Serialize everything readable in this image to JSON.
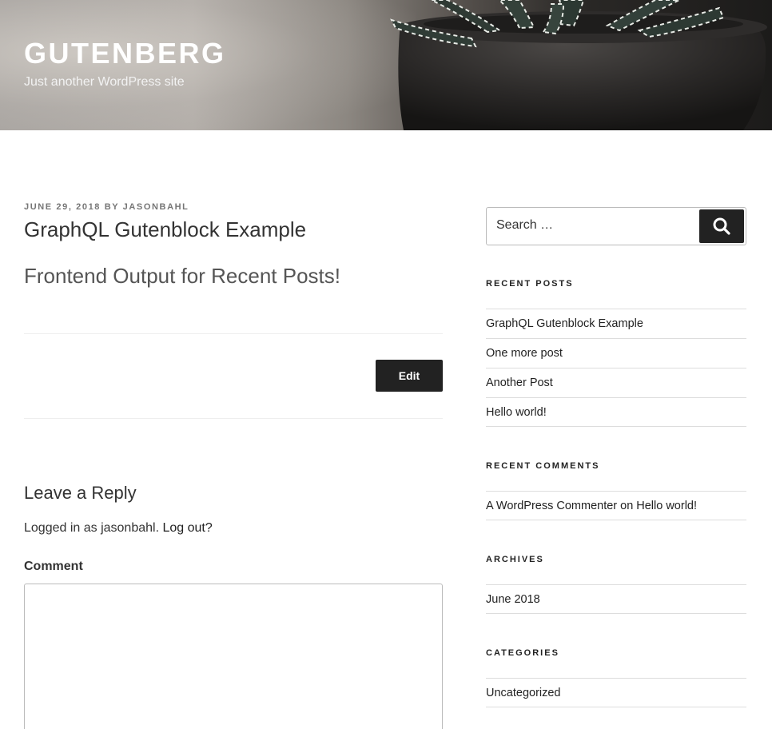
{
  "header": {
    "site_title": "GUTENBERG",
    "site_description": "Just another WordPress site"
  },
  "post": {
    "date": "JUNE 29, 2018",
    "by": "BY",
    "author": "JASONBAHL",
    "title": "GraphQL Gutenblock Example",
    "content": "Frontend Output for Recent Posts!",
    "edit_label": "Edit"
  },
  "comments": {
    "reply_title": "Leave a Reply",
    "logged_in_prefix": "Logged in as jasonbahl.",
    "logout_label": "Log out?",
    "comment_label": "Comment"
  },
  "sidebar": {
    "search_placeholder": "Search …",
    "recent_posts_title": "RECENT POSTS",
    "recent_posts": [
      "GraphQL Gutenblock Example",
      "One more post",
      "Another Post",
      "Hello world!"
    ],
    "recent_comments_title": "RECENT COMMENTS",
    "recent_comment": {
      "author": "A WordPress Commenter",
      "on": "on",
      "post": "Hello world!"
    },
    "archives_title": "ARCHIVES",
    "archives": [
      "June 2018"
    ],
    "categories_title": "CATEGORIES",
    "categories": [
      "Uncategorized"
    ]
  }
}
